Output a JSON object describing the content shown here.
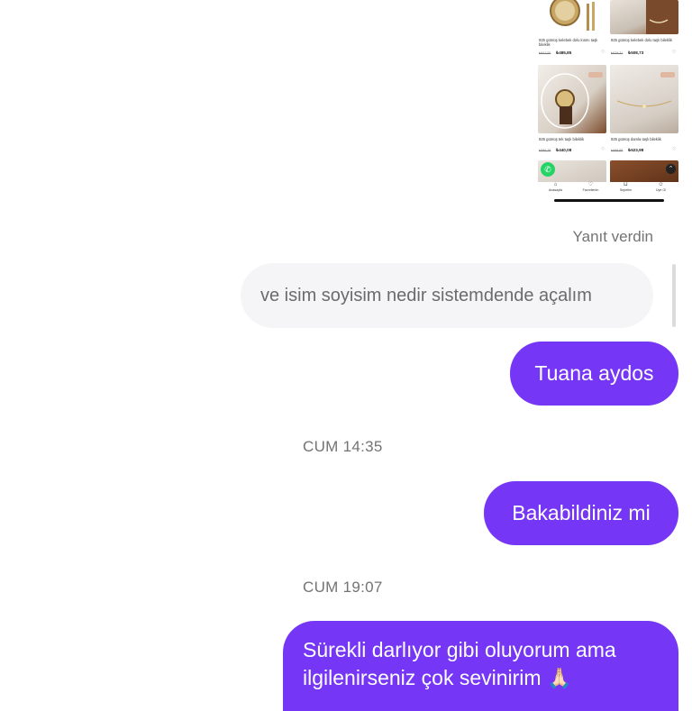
{
  "shared_screenshot": {
    "products": [
      {
        "name": "925 gümüş kelebek dolu kısmı taşlı bileklik",
        "old_price": "₺647,00",
        "price": "₺485,85"
      },
      {
        "name": "925 gümüş kelebek dolu taşlı bileklik",
        "old_price": "₺678,31",
        "price": "₺508,73"
      },
      {
        "name": "925 gümüş tek taşlı bileklik",
        "old_price": "₺586,78",
        "price": "₺440,08"
      },
      {
        "name": "925 gümüş damla taşlı bileklik",
        "old_price": "₺698,65",
        "price": "₺523,98"
      }
    ],
    "badge": "%25",
    "nav": [
      {
        "icon": "home-icon",
        "label": "Anasayfa"
      },
      {
        "icon": "heart-icon",
        "label": "Favorilerim"
      },
      {
        "icon": "cart-icon",
        "label": "Sepetim"
      },
      {
        "icon": "user-icon",
        "label": "Üye Ol"
      }
    ]
  },
  "reply_label": "Yanıt verdin",
  "quoted_message": "ve isim soyisim nedir sistemdende açalım",
  "messages": [
    {
      "text": "Tuana aydos"
    },
    {
      "timestamp": "CUM 14:35"
    },
    {
      "text": "Bakabildiniz mi"
    },
    {
      "timestamp": "CUM 19:07"
    },
    {
      "text": "Sürekli darlıyor gibi oluyorum ama ilgilenirseniz çok sevinirim",
      "emoji": "🙏🏻"
    }
  ],
  "colors": {
    "outgoing_bubble": "#7636f5",
    "quoted_bg": "#f5f5f7"
  }
}
